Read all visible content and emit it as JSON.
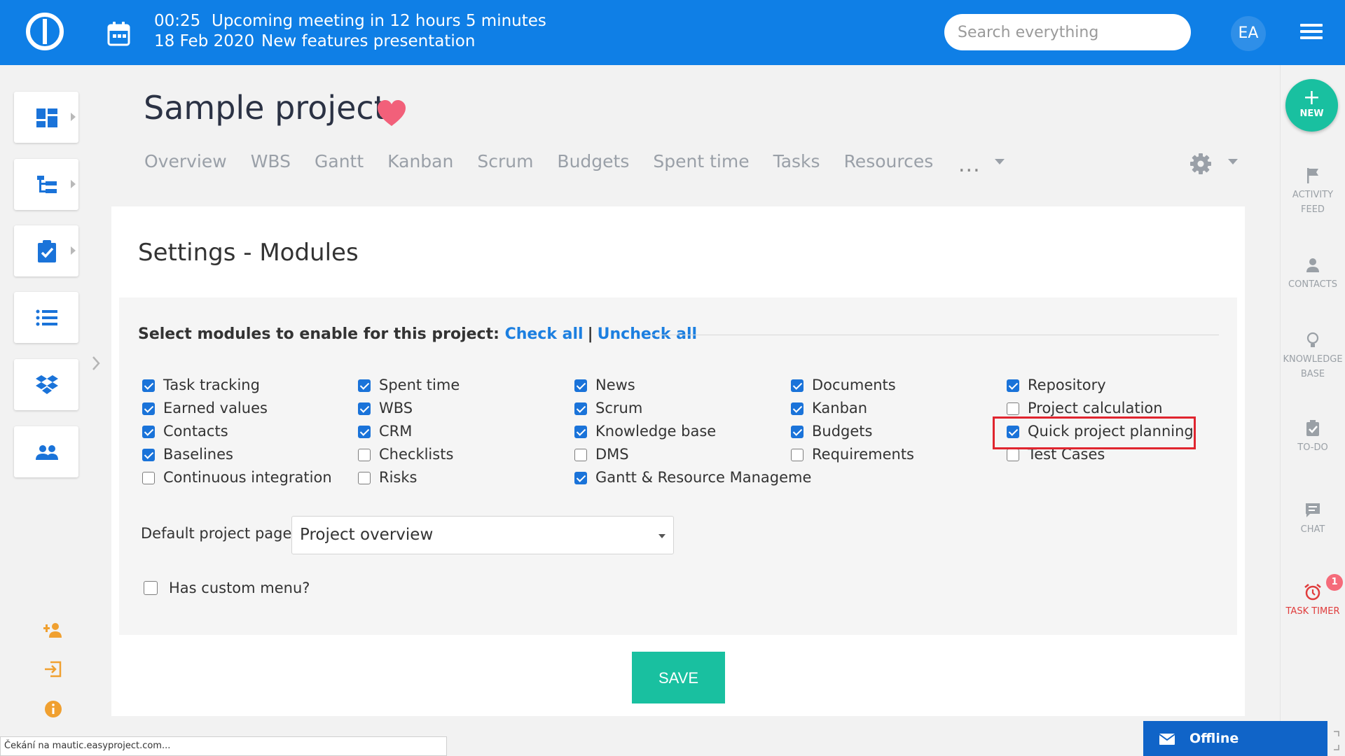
{
  "topbar": {
    "meeting_time": "00:25",
    "meeting_date": "18 Feb 2020",
    "meeting_status": "Upcoming meeting in 12 hours 5 minutes",
    "meeting_title": "New features presentation",
    "search_placeholder": "Search everything",
    "user_initials": "EA"
  },
  "project": {
    "title": "Sample project",
    "tabs": [
      "Overview",
      "WBS",
      "Gantt",
      "Kanban",
      "Scrum",
      "Budgets",
      "Spent time",
      "Tasks",
      "Resources"
    ],
    "more": "..."
  },
  "settings": {
    "title": "Settings - Modules",
    "modules_heading": "Select modules to enable for this project:",
    "check_all": "Check all",
    "separator": "|",
    "uncheck_all": "Uncheck all",
    "columns": [
      [
        {
          "label": "Task tracking",
          "checked": true
        },
        {
          "label": "Earned values",
          "checked": true
        },
        {
          "label": "Contacts",
          "checked": true
        },
        {
          "label": "Baselines",
          "checked": true
        },
        {
          "label": "Continuous integration",
          "checked": false
        }
      ],
      [
        {
          "label": "Spent time",
          "checked": true
        },
        {
          "label": "WBS",
          "checked": true
        },
        {
          "label": "CRM",
          "checked": true
        },
        {
          "label": "Checklists",
          "checked": false
        },
        {
          "label": "Risks",
          "checked": false
        }
      ],
      [
        {
          "label": "News",
          "checked": true
        },
        {
          "label": "Scrum",
          "checked": true
        },
        {
          "label": "Knowledge base",
          "checked": true
        },
        {
          "label": "DMS",
          "checked": false
        },
        {
          "label": "Gantt & Resource Manageme",
          "checked": true
        }
      ],
      [
        {
          "label": "Documents",
          "checked": true
        },
        {
          "label": "Kanban",
          "checked": true
        },
        {
          "label": "Budgets",
          "checked": true
        },
        {
          "label": "Requirements",
          "checked": false
        }
      ],
      [
        {
          "label": "Repository",
          "checked": true
        },
        {
          "label": "Project calculation",
          "checked": false
        },
        {
          "label": "Quick project planning",
          "checked": true,
          "highlighted": true
        },
        {
          "label": "Test Cases",
          "checked": false
        }
      ]
    ],
    "default_page_label": "Default project page",
    "default_page_value": "Project overview",
    "custom_menu_label": "Has custom menu?",
    "custom_menu_checked": false,
    "save_label": "SAVE"
  },
  "right_rail": {
    "new_label": "NEW",
    "items": [
      "ACTIVITY FEED",
      "CONTACTS",
      "KNOWLEDGE BASE",
      "TO-DO",
      "CHAT",
      "TASK TIMER"
    ],
    "activity_feed": [
      "ACTIVITY",
      "FEED"
    ],
    "knowledge_base": [
      "KNOWLEDGE",
      "BASE"
    ],
    "timer_badge": "1"
  },
  "statusbar": {
    "text": "Čekání na mautic.easyproject.com..."
  },
  "chat_widget": {
    "label": "Offline"
  },
  "colors": {
    "topbar": "#0f7fe6",
    "accent_green": "#19c0a0",
    "link_blue": "#1c7fe0",
    "highlight_red": "#e0252f",
    "sidebar_icon_blue": "#1a73d9",
    "footer_icon_orange": "#f0a030"
  },
  "icons": {
    "logo": "easy-logo-icon",
    "calendar": "calendar-icon",
    "menu": "hamburger-icon",
    "sidebar": [
      "dashboard-icon",
      "project-tree-icon",
      "tasks-clipboard-icon",
      "list-icon",
      "dropbox-icon",
      "users-icon"
    ],
    "footer": [
      "add-user-icon",
      "sign-in-icon",
      "info-icon"
    ]
  }
}
